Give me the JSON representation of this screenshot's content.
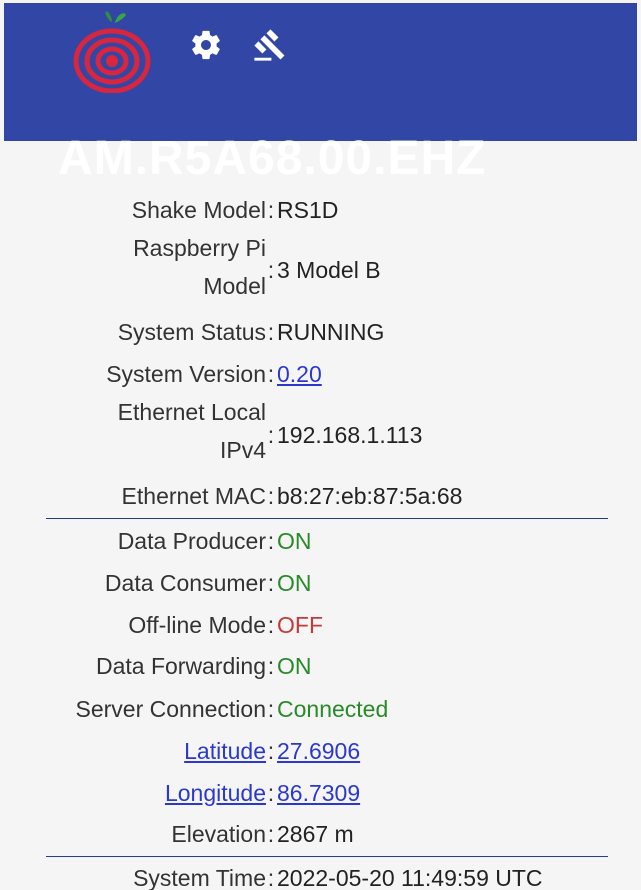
{
  "station_code": "AM.R5A68.00.EHZ",
  "rows_top": [
    {
      "label": "Shake Model",
      "value": "RS1D"
    },
    {
      "label_line1": "Raspberry Pi",
      "label_line2": "Model",
      "value": "3 Model B"
    },
    {
      "label": "System Status",
      "value": "RUNNING"
    },
    {
      "label": "System Version",
      "value": "0.20"
    },
    {
      "label_line1": "Ethernet Local",
      "label_line2": "IPv4",
      "value": "192.168.1.113"
    },
    {
      "label": "Ethernet MAC",
      "value": "b8:27:eb:87:5a:68"
    }
  ],
  "rows_mid": [
    {
      "label": "Data Producer",
      "value": "ON"
    },
    {
      "label": "Data Consumer",
      "value": "ON"
    },
    {
      "label": "Off-line Mode",
      "value": "OFF"
    },
    {
      "label": "Data Forwarding",
      "value": "ON"
    },
    {
      "label": "Server Connection",
      "value": "Connected"
    },
    {
      "label": "Latitude",
      "value": "27.6906"
    },
    {
      "label": "Longitude",
      "value": "86.7309"
    },
    {
      "label": "Elevation",
      "value": "2867 m"
    }
  ],
  "rows_bottom": [
    {
      "label": "System Time",
      "value": "2022-05-20 11:49:59 UTC"
    }
  ],
  "colon": ":",
  "colors": {
    "header": "#3247a5",
    "on": "#2a8a2a",
    "off": "#c43a3a",
    "link": "#2b38d0",
    "divider": "#233d91"
  },
  "icons": {
    "logo": "raspberry-shake-logo",
    "settings": "gear-icon",
    "tools": "gavel-icon"
  }
}
